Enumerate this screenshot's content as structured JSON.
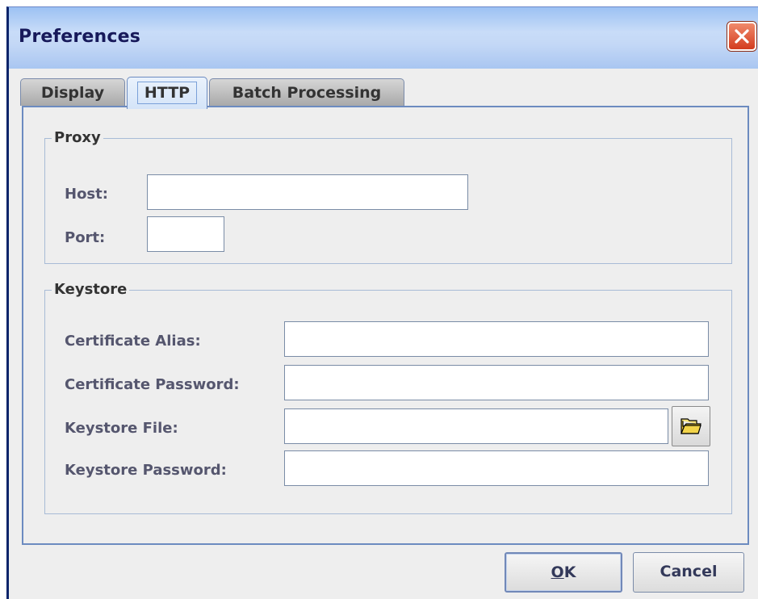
{
  "window": {
    "title": "Preferences"
  },
  "tabs": [
    {
      "label": "Display",
      "active": false
    },
    {
      "label": "HTTP",
      "active": true
    },
    {
      "label": "Batch Processing",
      "active": false
    }
  ],
  "proxy": {
    "legend": "Proxy",
    "host_label": "Host:",
    "host_value": "",
    "port_label": "Port:",
    "port_value": ""
  },
  "keystore": {
    "legend": "Keystore",
    "cert_alias_label": "Certificate Alias:",
    "cert_alias_value": "",
    "cert_password_label": "Certificate Password:",
    "cert_password_value": "",
    "file_label": "Keystore File:",
    "file_value": "",
    "password_label": "Keystore Password:",
    "password_value": ""
  },
  "buttons": {
    "ok_mnemonic": "O",
    "ok_rest": "K",
    "cancel": "Cancel"
  },
  "icons": {
    "close": "close-icon",
    "browse": "folder-icon"
  },
  "colors": {
    "title_text": "#17195a",
    "close_red": "#d33b1e",
    "tab_active_border": "#6c8bc0",
    "label_text": "#55566e"
  }
}
